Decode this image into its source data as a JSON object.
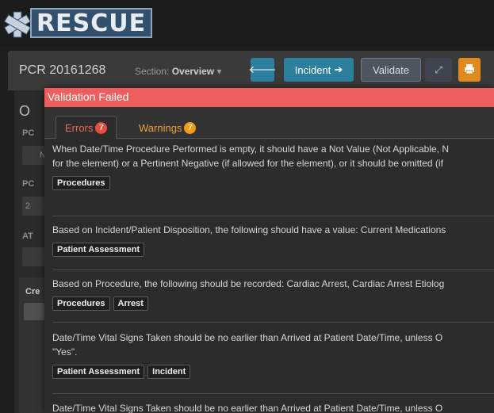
{
  "app": {
    "logo_text": "RESCUE"
  },
  "toolbar": {
    "pcr_title": "PCR 20161268",
    "section_label": "Section:",
    "section_value": "Overview",
    "incident_label": "Incident",
    "validate_label": "Validate"
  },
  "underlay": {
    "labels": [
      "O",
      "PC",
      "N",
      "PC",
      "2",
      "AT",
      "Cre"
    ]
  },
  "modal": {
    "title": "Validation Failed",
    "tabs": [
      {
        "label": "Errors",
        "count": "7"
      },
      {
        "label": "Warnings",
        "count": "7"
      }
    ],
    "items": [
      {
        "lines": [
          "When Date/Time Procedure Performed is empty, it should have a Not Value (Not Applicable, N",
          "for the element) or a Pertinent Negative (if allowed for the element), or it should be omitted (if"
        ],
        "tags": [
          "Procedures"
        ]
      },
      {
        "lines": [
          "Based on Incident/Patient Disposition, the following should have a value: Current Medications"
        ],
        "tags": [
          "Patient Assessment"
        ]
      },
      {
        "lines": [
          "Based on Procedure, the following should be recorded: Cardiac Arrest, Cardiac Arrest Etiolog"
        ],
        "tags": [
          "Procedures",
          "Arrest"
        ]
      },
      {
        "lines": [
          "Date/Time Vital Signs Taken should be no earlier than Arrived at Patient Date/Time, unless O",
          "\"Yes\"."
        ],
        "tags": [
          "Patient Assessment",
          "Incident"
        ]
      },
      {
        "lines": [
          "Date/Time Vital Signs Taken should be no earlier than Arrived at Patient Date/Time, unless O"
        ],
        "tags": []
      }
    ]
  },
  "colors": {
    "header": "#ee5e5e",
    "accent": "#2d7f9e",
    "print": "#e08a1e"
  }
}
